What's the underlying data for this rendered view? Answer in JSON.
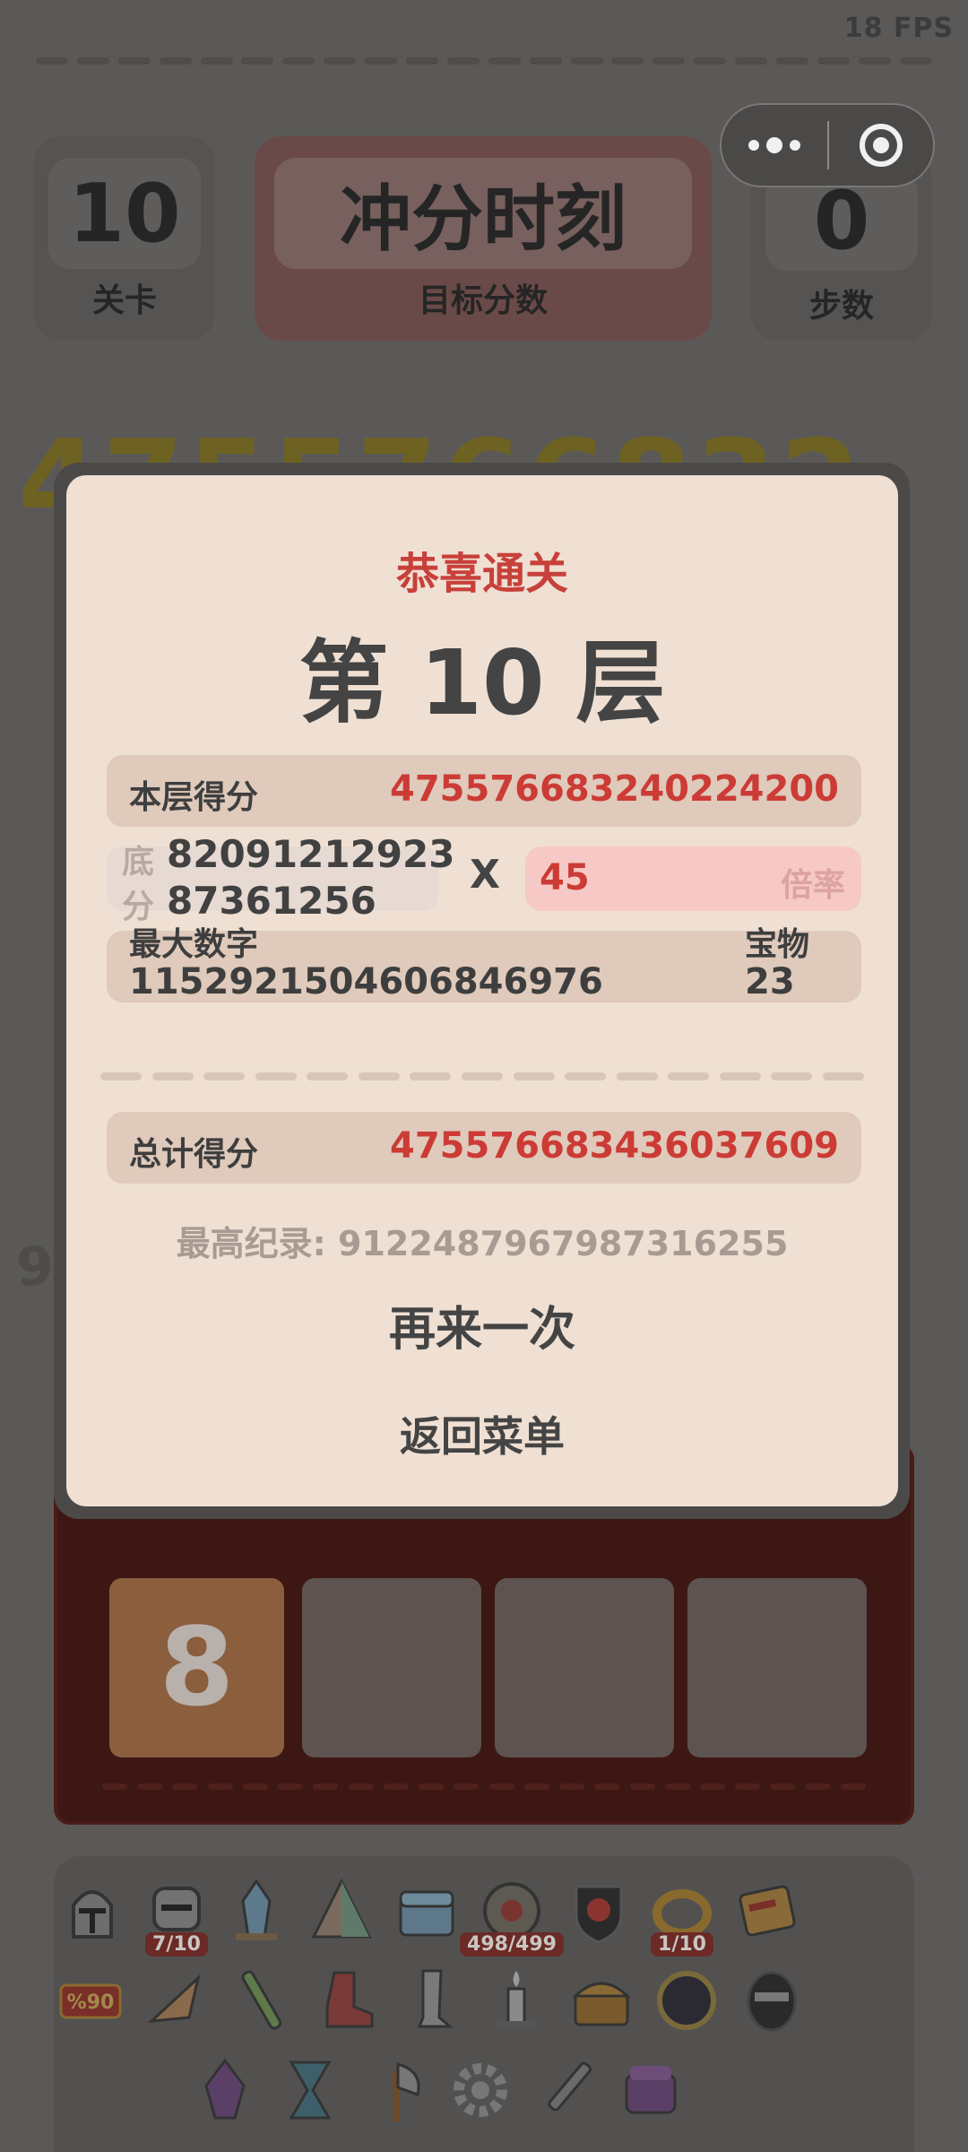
{
  "hud": {
    "fps": "18 FPS",
    "level": {
      "value": "10",
      "label": "关卡"
    },
    "target": {
      "value": "冲分时刻",
      "label": "目标分数"
    },
    "steps": {
      "value": "0",
      "label": "步数"
    }
  },
  "background": {
    "score_partial": "4755766832",
    "side_digit": "9"
  },
  "board": {
    "tile_value": "8"
  },
  "modal": {
    "title": "恭喜通关",
    "floor": "第 10 层",
    "floor_score_label": "本层得分",
    "floor_score_value": "475576683240224200",
    "base_label_1": "底",
    "base_label_2": "分",
    "base_line_1": "82091212923",
    "base_line_2": "87361256",
    "times": "X",
    "multiplier_value": "45",
    "multiplier_label": "倍率",
    "max_number_label": "最大数字",
    "max_number_value": "1152921504606846976",
    "treasure_label": "宝物",
    "treasure_value": "23",
    "total_label": "总计得分",
    "total_value": "475576683436037609",
    "record": "最高纪录: 9122487967987316255",
    "retry_button": "再来一次",
    "menu_button": "返回菜单"
  },
  "items": [
    {
      "icon": "knight-helmet-icon",
      "badge": ""
    },
    {
      "icon": "iron-helmet-icon",
      "badge": "7/10"
    },
    {
      "icon": "crystal-icon",
      "badge": ""
    },
    {
      "icon": "prism-icon",
      "badge": ""
    },
    {
      "icon": "chest-icon",
      "badge": ""
    },
    {
      "icon": "rune-stone-icon",
      "badge": "498/499"
    },
    {
      "icon": "skull-shield-icon",
      "badge": ""
    },
    {
      "icon": "gold-ring-icon",
      "badge": "1/10"
    },
    {
      "icon": "card-icon",
      "badge": ""
    },
    {
      "icon": "discount-tag-icon",
      "badge": "",
      "text": "%90"
    },
    {
      "icon": "drill-shell-icon",
      "badge": ""
    },
    {
      "icon": "flute-icon",
      "badge": ""
    },
    {
      "icon": "boot-icon",
      "badge": ""
    },
    {
      "icon": "greave-icon",
      "badge": ""
    },
    {
      "icon": "candle-icon",
      "badge": ""
    },
    {
      "icon": "treasure-chest-icon",
      "badge": ""
    },
    {
      "icon": "dark-orb-icon",
      "badge": ""
    },
    {
      "icon": "ninja-mask-icon",
      "badge": ""
    },
    {
      "icon": "purple-gem-icon",
      "badge": ""
    },
    {
      "icon": "hourglass-icon",
      "badge": ""
    },
    {
      "icon": "axe-icon",
      "badge": ""
    },
    {
      "icon": "gear-icon",
      "badge": ""
    },
    {
      "icon": "pen-icon",
      "badge": ""
    },
    {
      "icon": "magic-box-icon",
      "badge": ""
    }
  ],
  "colors": {
    "accent_red": "#cc3b35",
    "modal_bg": "#efe0d3",
    "row_bg": "#dfcabb"
  }
}
